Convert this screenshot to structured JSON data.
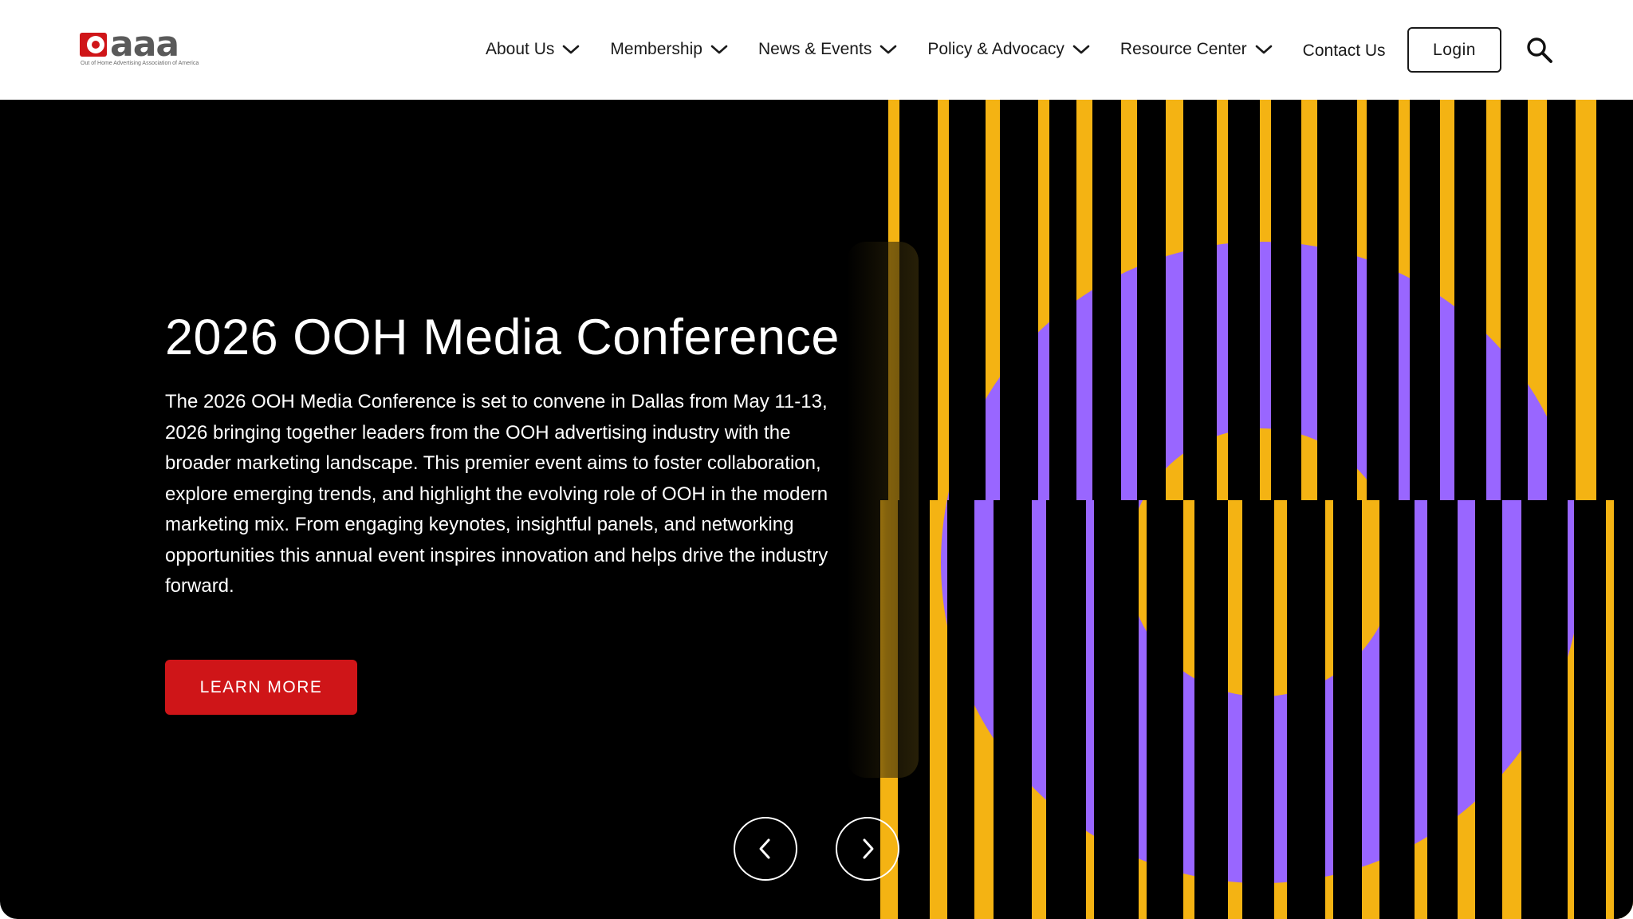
{
  "brand": {
    "logo_text": "aaa",
    "tagline": "Out of Home Advertising Association of America",
    "brand_red": "#cf1518"
  },
  "nav": {
    "items": [
      {
        "label": "About Us",
        "has_dropdown": true
      },
      {
        "label": "Membership",
        "has_dropdown": true
      },
      {
        "label": "News & Events",
        "has_dropdown": true
      },
      {
        "label": "Policy & Advocacy",
        "has_dropdown": true
      },
      {
        "label": "Resource Center",
        "has_dropdown": true
      }
    ],
    "contact_label": "Contact Us",
    "login_label": "Login",
    "search_icon": "search-icon",
    "dropdown_icon": "chevron-down-icon"
  },
  "hero": {
    "title": "2026 OOH Media Conference",
    "body": "The 2026 OOH Media Conference is set to convene in Dallas from May 11-13, 2026 bringing together leaders from the OOH advertising industry with the broader marketing landscape. This premier event aims to foster collaboration, explore emerging trends, and highlight the evolving role of OOH in the modern marketing mix. From engaging keynotes, insightful panels, and networking opportunities this annual event inspires innovation and helps drive the industry forward.",
    "cta_label": "LEARN MORE",
    "prev_icon": "chevron-left-icon",
    "next_icon": "chevron-right-icon",
    "colors": {
      "background": "#000000",
      "stripe_yellow": "#f4b313",
      "circle_purple": "#9966ff"
    }
  }
}
